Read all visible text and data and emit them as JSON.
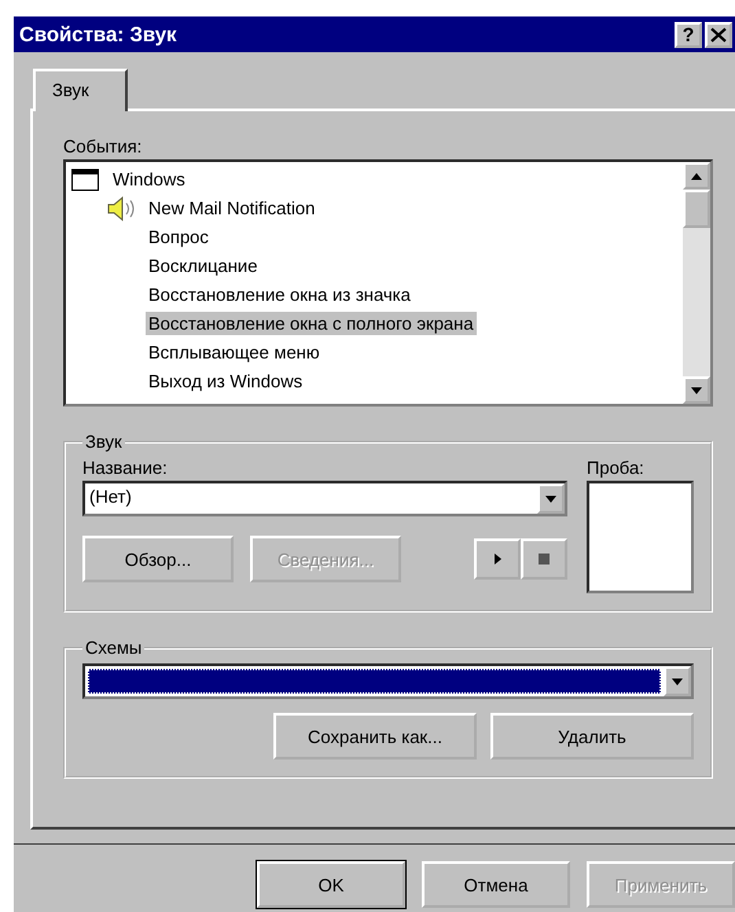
{
  "window": {
    "title": "Свойства: Звук",
    "help_button": "?"
  },
  "tabs": [
    {
      "label": "Звук",
      "selected": true
    }
  ],
  "events": {
    "label": "События:",
    "items": [
      {
        "label": "Windows",
        "selected": false,
        "children": [
          {
            "label": "New Mail Notification",
            "sound": true,
            "selected": false
          },
          {
            "label": "Вопрос",
            "sound": false,
            "selected": false
          },
          {
            "label": "Восклицание",
            "sound": false,
            "selected": false
          },
          {
            "label": "Восстановление окна из значка",
            "sound": false,
            "selected": false
          },
          {
            "label": "Восстановление окна с полного экрана",
            "sound": false,
            "selected": true
          },
          {
            "label": "Всплывающее меню",
            "sound": false,
            "selected": false
          },
          {
            "label": "Выход из Windows",
            "sound": false,
            "selected": false
          }
        ]
      }
    ]
  },
  "sound_group": {
    "title": "Звук",
    "name_label": "Название:",
    "name_value": "(Нет)",
    "preview_label": "Проба:",
    "buttons": [
      {
        "label": "Обзор...",
        "disabled": false
      },
      {
        "label": "Сведения...",
        "disabled": true
      }
    ]
  },
  "schemes_group": {
    "title": "Схемы",
    "selected_value_highlighted": true,
    "buttons": [
      {
        "label": "Сохранить как...",
        "disabled": false
      },
      {
        "label": "Удалить",
        "disabled": false
      }
    ]
  },
  "dialog_buttons": [
    {
      "label": "OK",
      "disabled": false,
      "default": true
    },
    {
      "label": "Отмена",
      "disabled": false,
      "default": false
    },
    {
      "label": "Применить",
      "disabled": true,
      "default": false
    }
  ]
}
